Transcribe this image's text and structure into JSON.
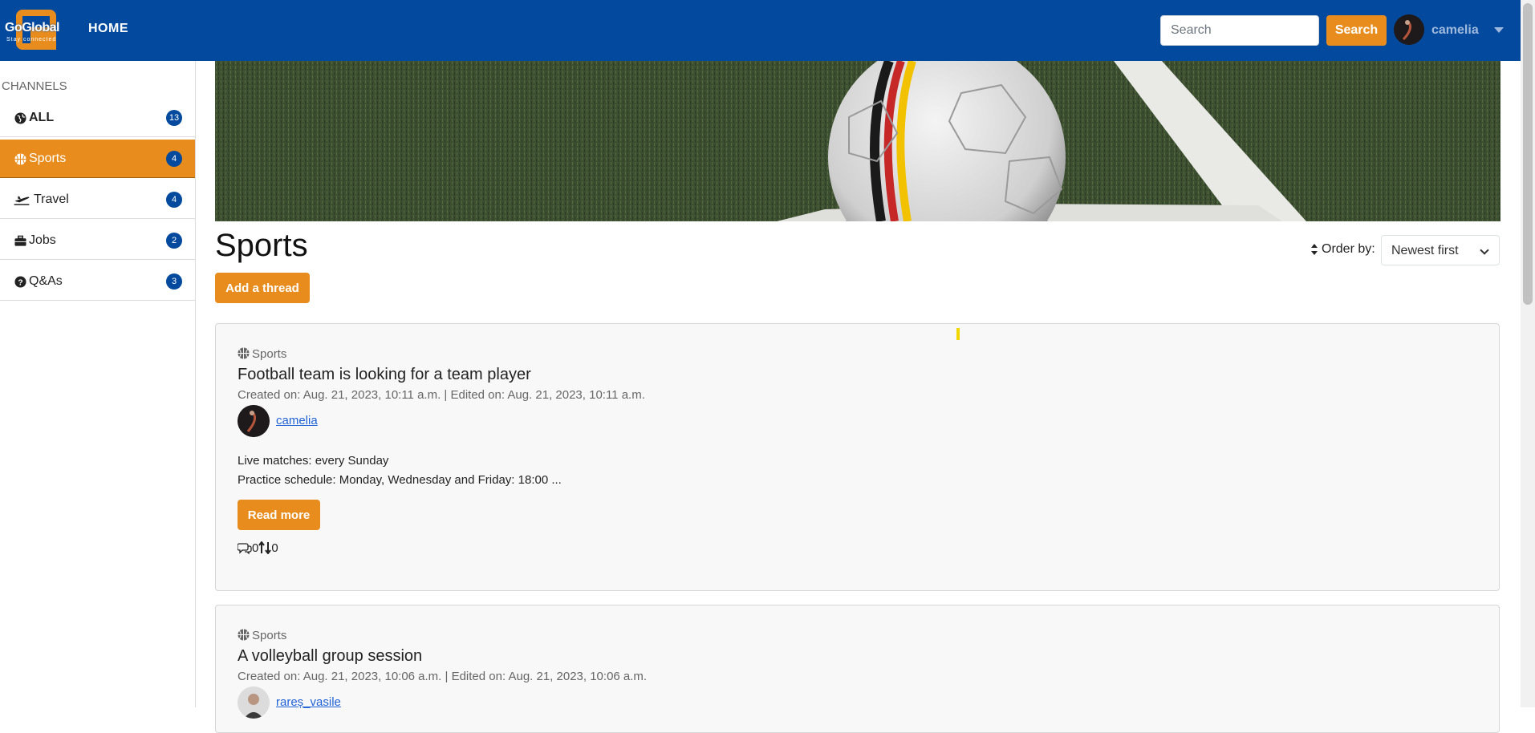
{
  "header": {
    "logo_text": "GoGlobal",
    "logo_tagline": "Stay connected",
    "home_label": "HOME",
    "search_placeholder": "Search",
    "search_button": "Search",
    "user_name": "camelia"
  },
  "sidebar": {
    "heading": "CHANNELS",
    "items": [
      {
        "label": "ALL",
        "count": "13",
        "icon": "globe-icon"
      },
      {
        "label": "Sports",
        "count": "4",
        "icon": "basketball-icon",
        "active": true
      },
      {
        "label": "Travel",
        "count": "4",
        "icon": "plane-icon"
      },
      {
        "label": "Jobs",
        "count": "2",
        "icon": "briefcase-icon"
      },
      {
        "label": "Q&As",
        "count": "3",
        "icon": "question-circle-icon"
      }
    ]
  },
  "main": {
    "title": "Sports",
    "add_thread": "Add a thread",
    "order_label": "Order by:",
    "order_value": "Newest first"
  },
  "threads": [
    {
      "channel": "Sports",
      "title": "Football team is looking for a team player",
      "meta": "Created on: Aug. 21, 2023, 10:11 a.m. | Edited on: Aug. 21, 2023, 10:11 a.m.",
      "author": "camelia",
      "body_line1": "Live matches: every Sunday",
      "body_line2": "Practice schedule: Monday, Wednesday and Friday: 18:00 ...",
      "read_more": "Read more",
      "comments": "0",
      "votes": "0"
    },
    {
      "channel": "Sports",
      "title": "A volleyball group session",
      "meta": "Created on: Aug. 21, 2023, 10:06 a.m. | Edited on: Aug. 21, 2023, 10:06 a.m.",
      "author": "rareș_vasile"
    }
  ],
  "colors": {
    "navbar": "#034a9e",
    "accent": "#e88d1d",
    "badge": "#034a9e",
    "link": "#1f62d6"
  }
}
